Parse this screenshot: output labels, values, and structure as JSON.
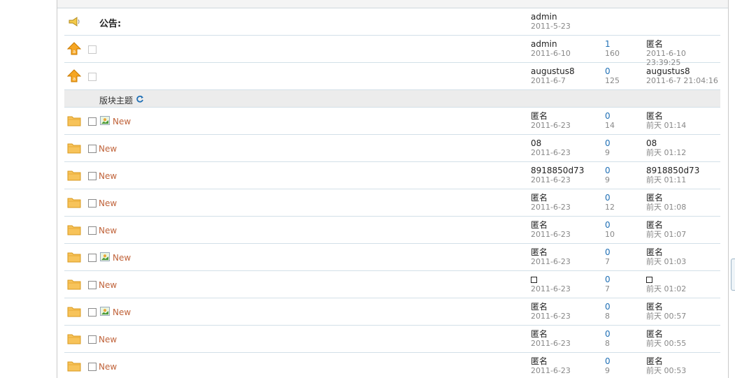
{
  "notice": {
    "title": "公告:",
    "author": "admin",
    "date": "2011-5-23"
  },
  "sticky": [
    {
      "author": "admin",
      "date": "2011-6-10",
      "replies": "1",
      "views": "160",
      "last_author": "匿名",
      "last_time": "2011-6-10 23:39:25"
    },
    {
      "author": "augustus8",
      "date": "2011-6-7",
      "replies": "0",
      "views": "125",
      "last_author": "augustus8",
      "last_time": "2011-6-7 21:04:16"
    }
  ],
  "section": {
    "title": "版块主题"
  },
  "threads": [
    {
      "has_image": true,
      "new_label": "New",
      "author": "匿名",
      "date": "2011-6-23",
      "replies": "0",
      "views": "14",
      "last_author": "匿名",
      "last_time": "前天 01:14"
    },
    {
      "has_image": false,
      "new_label": "New",
      "author": "08",
      "date": "2011-6-23",
      "replies": "0",
      "views": "9",
      "last_author": "08",
      "last_time": "前天 01:12"
    },
    {
      "has_image": false,
      "new_label": "New",
      "author": "8918850d73",
      "date": "2011-6-23",
      "replies": "0",
      "views": "9",
      "last_author": "8918850d73",
      "last_time": "前天 01:11"
    },
    {
      "has_image": false,
      "new_label": "New",
      "author": "匿名",
      "date": "2011-6-23",
      "replies": "0",
      "views": "12",
      "last_author": "匿名",
      "last_time": "前天 01:08"
    },
    {
      "has_image": false,
      "new_label": "New",
      "author": "匿名",
      "date": "2011-6-23",
      "replies": "0",
      "views": "10",
      "last_author": "匿名",
      "last_time": "前天 01:07"
    },
    {
      "has_image": true,
      "new_label": "New",
      "author": "匿名",
      "date": "2011-6-23",
      "replies": "0",
      "views": "7",
      "last_author": "匿名",
      "last_time": "前天 01:03"
    },
    {
      "has_image": false,
      "new_label": "New",
      "author": "",
      "author_box": true,
      "date": "2011-6-23",
      "replies": "0",
      "views": "7",
      "last_author": "",
      "last_box": true,
      "last_time": "前天 01:02"
    },
    {
      "has_image": true,
      "new_label": "New",
      "author": "匿名",
      "date": "2011-6-23",
      "replies": "0",
      "views": "8",
      "last_author": "匿名",
      "last_time": "前天 00:57"
    },
    {
      "has_image": false,
      "new_label": "New",
      "author": "匿名",
      "date": "2011-6-23",
      "replies": "0",
      "views": "8",
      "last_author": "匿名",
      "last_time": "前天 00:55"
    },
    {
      "has_image": false,
      "new_label": "New",
      "author": "匿名",
      "date": "2011-6-23",
      "replies": "0",
      "views": "9",
      "last_author": "匿名",
      "last_time": "前天 00:53"
    }
  ]
}
